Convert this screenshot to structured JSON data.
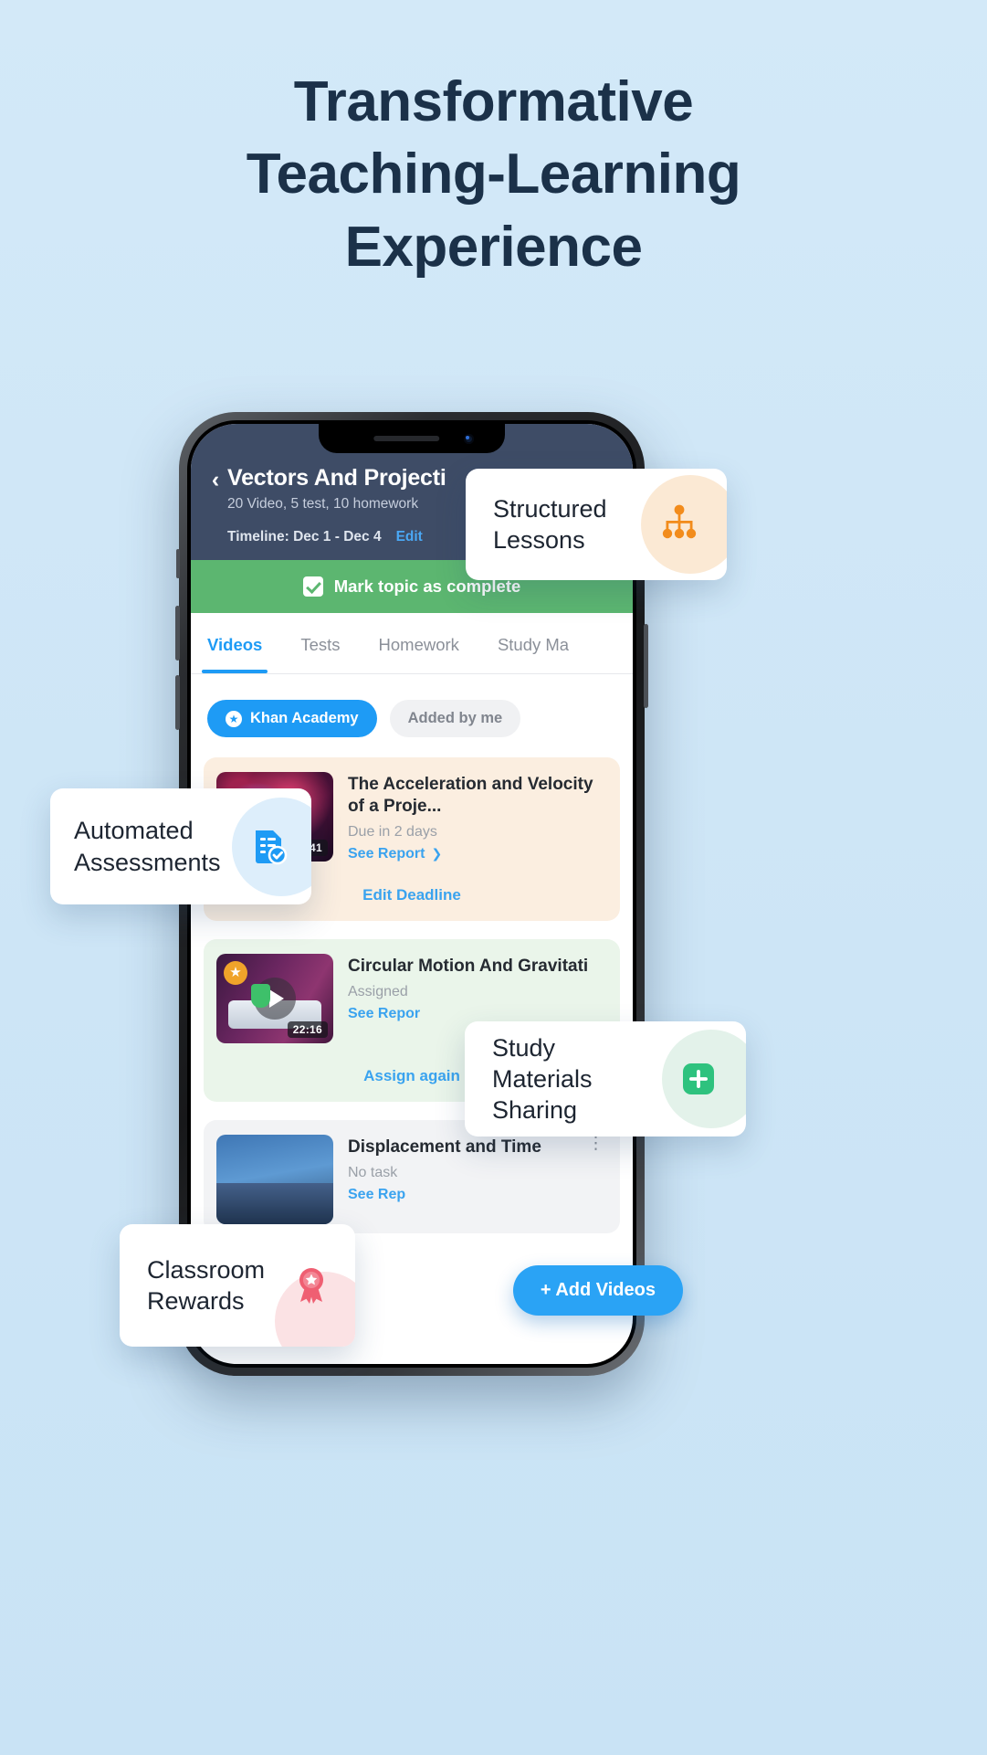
{
  "headline": {
    "line1": "Transformative",
    "line2": "Teaching-Learning",
    "line3": "Experience"
  },
  "colors": {
    "background": "#cfe7f7",
    "headline_text": "#1b3149",
    "app_header": "#3e4c66",
    "accent_blue": "#1e9bf5",
    "green_bar": "#5cb670",
    "orange_icon": "#f28c1c",
    "mint_icon": "#2ec27e",
    "pink_icon": "#ef5f72"
  },
  "phone": {
    "header": {
      "back_icon": "chevron-left-icon",
      "title": "Vectors And Projecti",
      "subtitle": "20 Video, 5 test, 10 homework",
      "timeline_label": "Timeline: Dec 1 - Dec 4",
      "edit_label": "Edit"
    },
    "complete_bar": {
      "label": "Mark topic as complete",
      "checked": true
    },
    "tabs": [
      {
        "label": "Videos",
        "active": true
      },
      {
        "label": "Tests",
        "active": false
      },
      {
        "label": "Homework",
        "active": false
      },
      {
        "label": "Study Ma",
        "active": false
      }
    ],
    "chips": [
      {
        "label": "Khan Academy",
        "selected": true,
        "icon": "star-icon"
      },
      {
        "label": "Added by me",
        "selected": false
      }
    ],
    "videos": [
      {
        "title": "The Acceleration and Velocity of a Proje...",
        "meta": "Due in 2 days",
        "link": "See Report",
        "duration": "25:41",
        "footer_action": "Edit Deadline",
        "has_play": false,
        "has_star": false
      },
      {
        "title": "Circular Motion And Gravitati",
        "meta": "Assigned",
        "link": "See Repor",
        "duration": "22:16",
        "footer_action": "Assign again",
        "has_play": true,
        "has_star": true
      },
      {
        "title": "Displacement and Time",
        "meta": "No task",
        "link": "See Rep",
        "duration": "",
        "footer_action": "",
        "has_play": false,
        "has_star": false,
        "menu_icon": "kebab-menu-icon"
      }
    ],
    "fab": {
      "label": "+ Add Videos"
    }
  },
  "feature_cards": [
    {
      "id": "structured",
      "line1": "Structured",
      "line2": "Lessons",
      "icon": "org-chart-icon"
    },
    {
      "id": "automated",
      "line1": "Automated",
      "line2": "Assessments",
      "icon": "document-check-icon"
    },
    {
      "id": "study",
      "line1": "Study Materials",
      "line2": "Sharing",
      "icon": "plus-square-icon"
    },
    {
      "id": "rewards",
      "line1": "Classroom",
      "line2": "Rewards",
      "icon": "award-ribbon-icon"
    }
  ]
}
